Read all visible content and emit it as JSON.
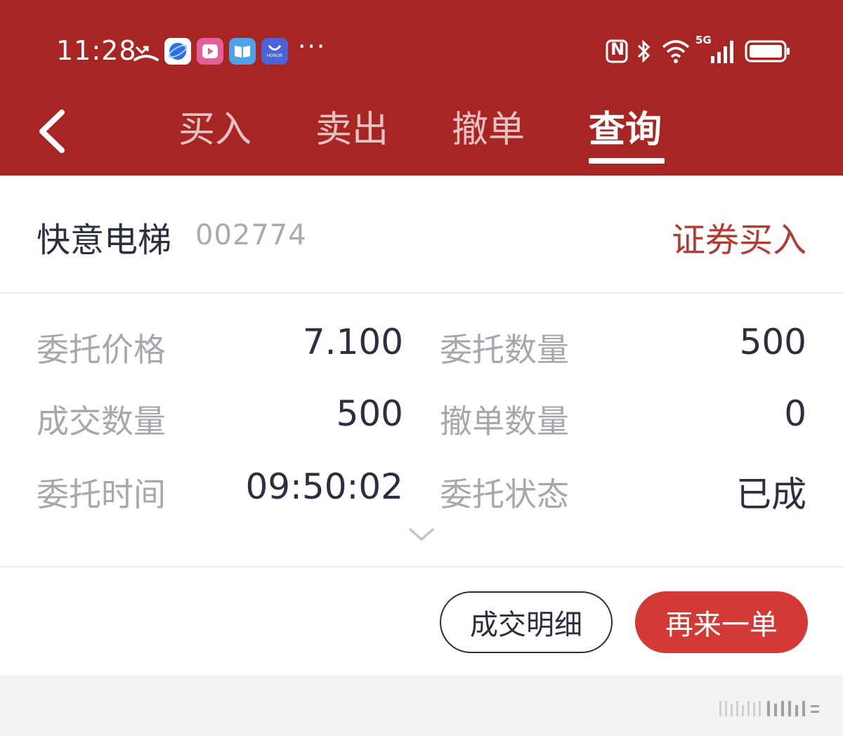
{
  "status_bar": {
    "time": "11:28",
    "icons": [
      "missed-call-icon",
      "browser-app-icon",
      "video-app-icon",
      "reader-app-icon",
      "store-app-icon",
      "more-dots-icon",
      "nfc-icon",
      "bluetooth-icon",
      "wifi-icon",
      "5g-signal-icon",
      "battery-icon"
    ],
    "more": "···",
    "network": "5G",
    "nfc_letter": "N",
    "store_brand": "HONOR"
  },
  "nav": {
    "tabs": [
      {
        "label": "买入"
      },
      {
        "label": "卖出"
      },
      {
        "label": "撤单"
      },
      {
        "label": "查询",
        "active": true
      }
    ]
  },
  "order": {
    "stock_name": "快意电梯",
    "stock_code": "002774",
    "order_type": "证券买入",
    "fields": {
      "entrust_price": {
        "label": "委托价格",
        "value": "7.100"
      },
      "entrust_qty": {
        "label": "委托数量",
        "value": "500"
      },
      "filled_qty": {
        "label": "成交数量",
        "value": "500"
      },
      "cancel_qty": {
        "label": "撤单数量",
        "value": "0"
      },
      "entrust_time": {
        "label": "委托时间",
        "value": "09:50:02"
      },
      "entrust_status": {
        "label": "委托状态",
        "value": "已成"
      }
    }
  },
  "actions": {
    "detail_label": "成交明细",
    "again_label": "再来一单"
  },
  "colors": {
    "header_bg": "#a72624",
    "accent_red": "#d43a35",
    "order_type_red": "#b53a32",
    "text_dark": "#2b2f3e",
    "text_gray": "#a6a8ae"
  }
}
